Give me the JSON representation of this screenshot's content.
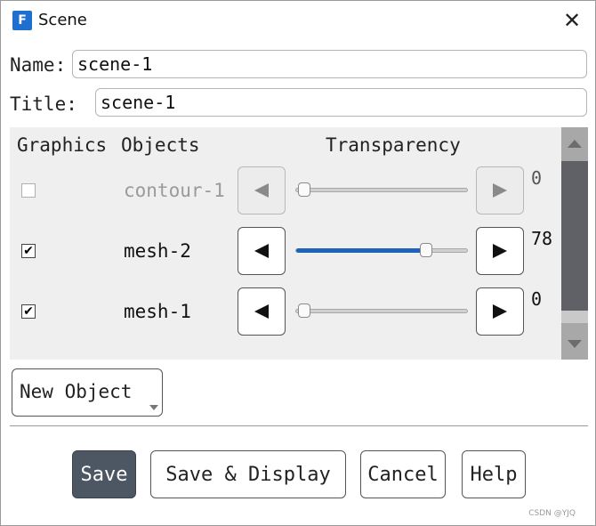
{
  "window": {
    "title": "Scene",
    "app_icon_letter": "F",
    "close_glyph": "✕"
  },
  "form": {
    "name_label": "Name:",
    "name_value": "scene-1",
    "title_label": "Title:",
    "title_value": "scene-1"
  },
  "objects_panel": {
    "header_graphics": "Graphics",
    "header_objects": "Objects",
    "header_transparency": "Transparency",
    "rows": [
      {
        "name": "contour-1",
        "checked": false,
        "enabled": false,
        "transparency": 0,
        "value_text": "0"
      },
      {
        "name": "mesh-2",
        "checked": true,
        "enabled": true,
        "transparency": 78,
        "value_text": "78"
      },
      {
        "name": "mesh-1",
        "checked": true,
        "enabled": true,
        "transparency": 0,
        "value_text": "0"
      }
    ],
    "slider_max": 100
  },
  "new_object": {
    "label": "New Object"
  },
  "buttons": {
    "save": "Save",
    "save_display": "Save & Display",
    "cancel": "Cancel",
    "help": "Help"
  },
  "colors": {
    "accent": "#1f63b8",
    "primary_button": "#4d5763",
    "panel_bg": "#efefef"
  },
  "icons": {
    "app": "fluent-app-icon",
    "close": "close-icon",
    "decrease": "triangle-left-icon",
    "increase": "triangle-right-icon",
    "scroll_up": "triangle-up-icon",
    "scroll_down": "triangle-down-icon",
    "dropdown": "chevron-down-icon"
  },
  "watermark": "CSDN @YJQ"
}
